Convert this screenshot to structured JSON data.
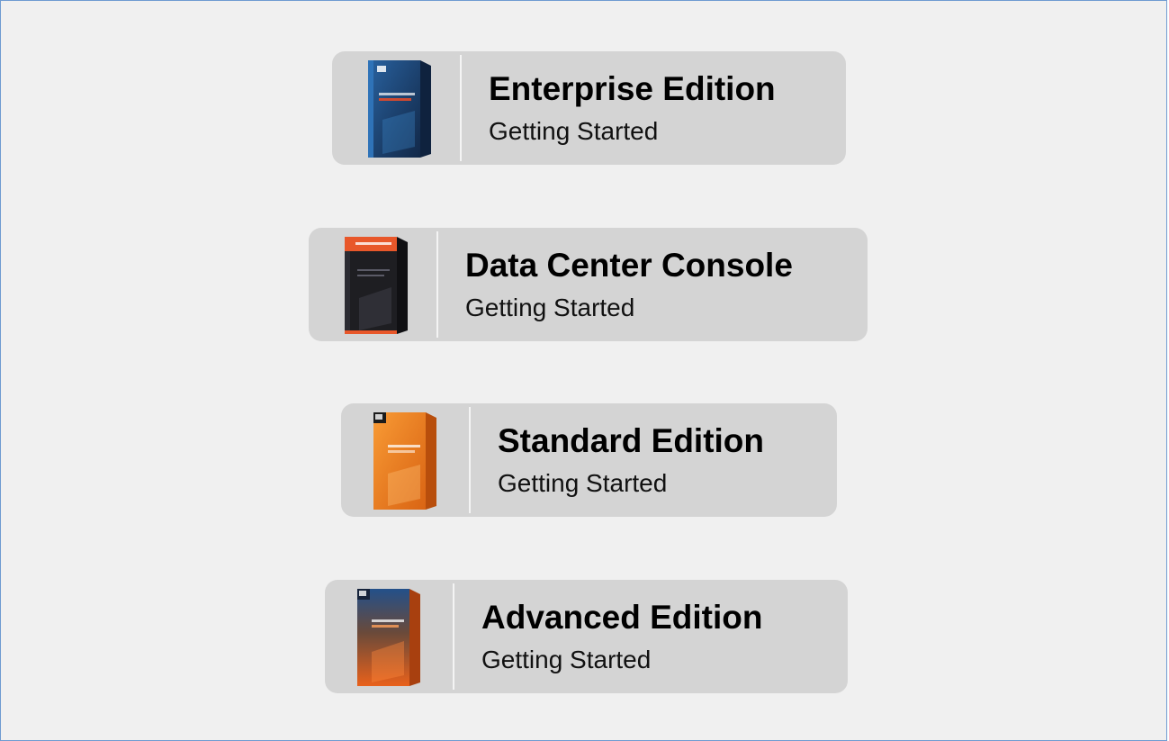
{
  "products": [
    {
      "title": "Enterprise Edition",
      "subtitle": "Getting Started",
      "icon": "enterprise-box-icon",
      "colors": {
        "front": "#1d3f6e",
        "accent": "#2f73b8",
        "side": "#0f223e"
      }
    },
    {
      "title": "Data Center Console",
      "subtitle": "Getting Started",
      "icon": "data-center-box-icon",
      "colors": {
        "front": "#1e1e22",
        "accent": "#e8572a",
        "side": "#101013"
      }
    },
    {
      "title": "Standard Edition",
      "subtitle": "Getting Started",
      "icon": "standard-box-icon",
      "colors": {
        "front": "#f07a1c",
        "accent": "#ffb347",
        "side": "#b84e0c"
      }
    },
    {
      "title": "Advanced Edition",
      "subtitle": "Getting Started",
      "icon": "advanced-box-icon",
      "colors": {
        "front": "#e9611b",
        "accent": "#23508a",
        "side": "#a8400f"
      }
    }
  ]
}
